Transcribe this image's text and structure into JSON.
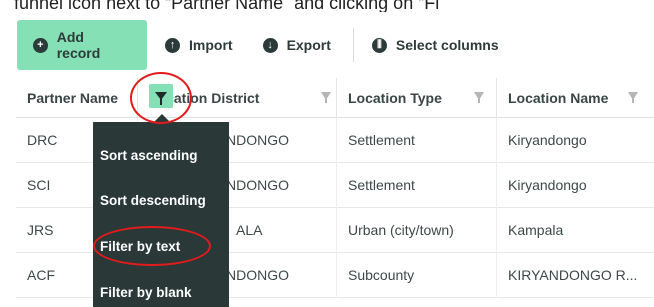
{
  "caption": "funnel icon next to “Partner Name” and clicking on “Fi",
  "toolbar": {
    "add_record": "Add record",
    "import": "Import",
    "export": "Export",
    "select_columns": "Select columns"
  },
  "columns": [
    "Partner Name",
    "Location District",
    "Location Type",
    "Location Name"
  ],
  "rows": [
    [
      "DRC",
      "NDONGO",
      "Settlement",
      "Kiryandongo"
    ],
    [
      "SCI",
      "NDONGO",
      "Settlement",
      "Kiryandongo"
    ],
    [
      "JRS",
      "ALA",
      "Urban (city/town)",
      "Kampala"
    ],
    [
      "ACF",
      "NDONGO",
      "Subcounty",
      "KIRYANDONGO R..."
    ]
  ],
  "menu": {
    "items": [
      "Sort ascending",
      "Sort descending",
      "Filter by text",
      "Filter by blank"
    ]
  },
  "colors": {
    "accent": "#85e0b5",
    "menu_bg": "#2b3838",
    "highlight_ring": "#e21b1b"
  },
  "icons": {
    "add": "plus-circle-icon",
    "import": "upload-circle-icon",
    "export": "download-circle-icon",
    "columns": "columns-circle-icon",
    "filter": "funnel-icon"
  }
}
